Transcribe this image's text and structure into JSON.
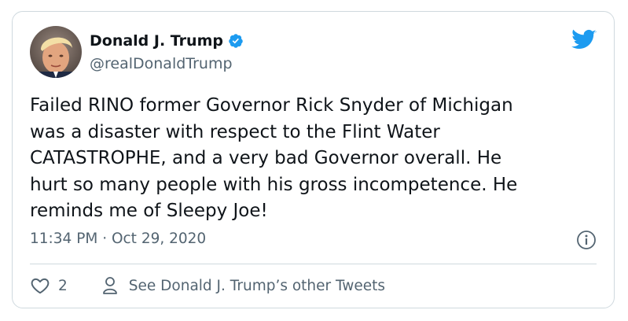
{
  "tweet": {
    "display_name": "Donald J. Trump",
    "handle": "@realDonaldTrump",
    "verified": true,
    "text": "Failed RINO former Governor Rick Snyder of Michigan\nwas a disaster with respect to the Flint Water\nCATASTROPHE, and a very bad Governor overall. He\nhurt so many people with his gross incompetence. He\nreminds me of Sleepy Joe!",
    "timestamp": "11:34 PM · Oct 29, 2020",
    "like_count": "2",
    "profile_link_text": "See Donald J. Trump’s other Tweets"
  },
  "icons": {
    "brand": "twitter-bird-icon",
    "verified": "verified-badge-icon",
    "info": "info-icon",
    "like": "heart-icon",
    "profile": "person-icon"
  },
  "colors": {
    "twitter_blue": "#1d9bf0",
    "text_primary": "#0f1419",
    "text_secondary": "#536471",
    "border": "#cfd9de"
  }
}
